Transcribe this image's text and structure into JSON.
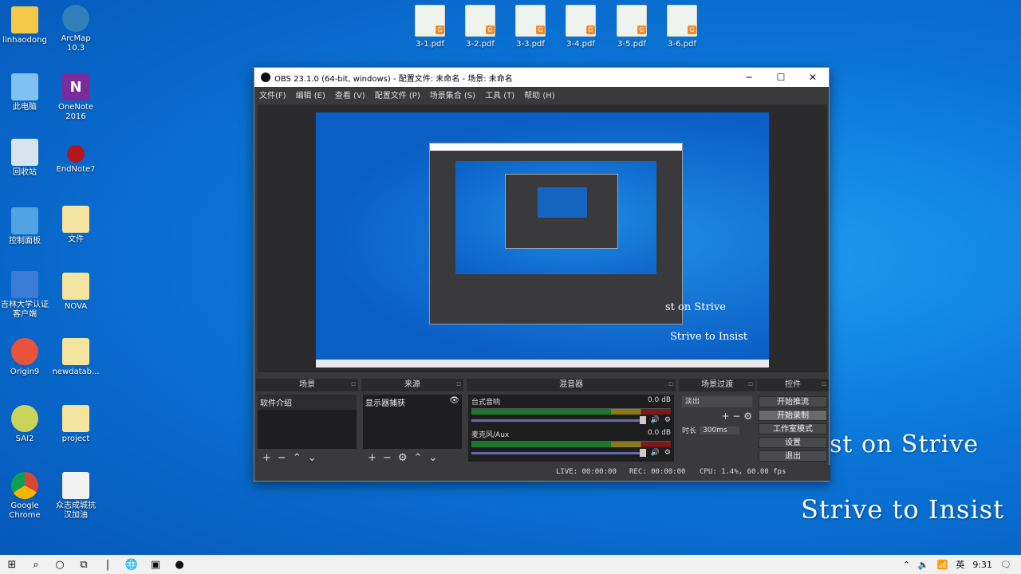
{
  "desktop": {
    "left_icons": [
      {
        "label": "linhaodong",
        "icon": "user-folder-icon"
      },
      {
        "label": "ArcMap\n10.3",
        "icon": "arcmap-globe-icon"
      },
      {
        "label": "此电脑",
        "icon": "computer-icon"
      },
      {
        "label": "OneNote\n2016",
        "icon": "onenote-icon"
      },
      {
        "label": "回收站",
        "icon": "recycle-bin-icon"
      },
      {
        "label": "EndNote7",
        "icon": "endnote-icon"
      },
      {
        "label": "控制面板",
        "icon": "control-panel-icon"
      },
      {
        "label": "文件",
        "icon": "folder-icon"
      },
      {
        "label": "吉林大学认证\n客户端",
        "icon": "network-client-icon"
      },
      {
        "label": "NOVA",
        "icon": "folder-icon"
      },
      {
        "label": "Origin9",
        "icon": "origin-icon"
      },
      {
        "label": "newdatab...",
        "icon": "folder-icon"
      },
      {
        "label": "SAI2",
        "icon": "sai-icon"
      },
      {
        "label": "project",
        "icon": "folder-icon"
      },
      {
        "label": "Google\nChrome",
        "icon": "chrome-icon"
      },
      {
        "label": "众志成城抗\n汉加油",
        "icon": "document-icon"
      }
    ],
    "pdf_files": [
      "3-1.pdf",
      "3-2.pdf",
      "3-3.pdf",
      "3-4.pdf",
      "3-5.pdf",
      "3-6.pdf"
    ],
    "watermark_line1": "st on Strive",
    "watermark_line2": "Strive to Insist"
  },
  "obs": {
    "title": "OBS 23.1.0 (64-bit, windows) - 配置文件: 未命名 - 场景: 未命名",
    "menu": [
      "文件(F)",
      "编辑 (E)",
      "查看 (V)",
      "配置文件 (P)",
      "场景集合 (S)",
      "工具 (T)",
      "帮助 (H)"
    ],
    "preview_text1": "st on Strive",
    "preview_text2": "Strive to Insist",
    "docks": {
      "scenes": {
        "title": "场景",
        "items": [
          "软件介绍"
        ]
      },
      "sources": {
        "title": "来源",
        "items": [
          "显示器捕获"
        ]
      },
      "mixer": {
        "title": "混音器",
        "channels": [
          {
            "name": "台式音响",
            "level": "0.0 dB"
          },
          {
            "name": "麦克风/Aux",
            "level": "0.0 dB"
          }
        ]
      },
      "transitions": {
        "title": "场景过渡",
        "selected": "淡出",
        "duration_label": "时长",
        "duration_value": "300ms"
      },
      "controls": {
        "title": "控件",
        "buttons": [
          "开始推流",
          "开始录制",
          "工作室模式",
          "设置",
          "退出"
        ]
      }
    },
    "status": {
      "live": "LIVE: 00:00:00",
      "rec": "REC: 00:00:00",
      "cpu": "CPU: 1.4%, 60.00 fps"
    }
  },
  "taskbar": {
    "time": "9:31",
    "ime": "英"
  }
}
